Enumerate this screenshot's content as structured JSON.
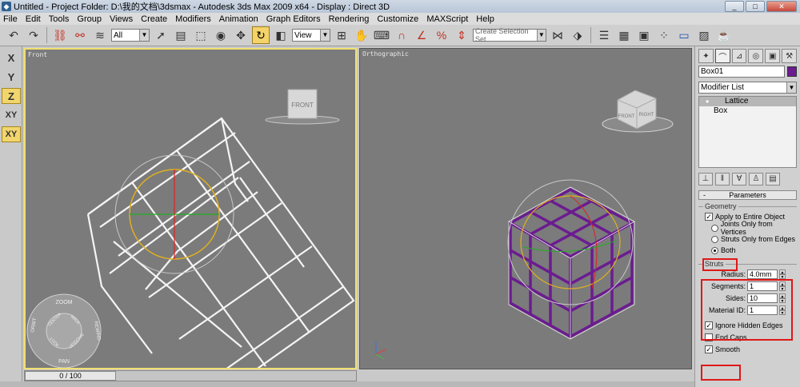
{
  "window": {
    "title": "Untitled    - Project Folder: D:\\我的文档\\3dsmax    - Autodesk 3ds Max  2009 x64    - Display : Direct 3D",
    "buttons": {
      "minimize": "_",
      "maximize": "□",
      "close": "✕"
    }
  },
  "menu": [
    "File",
    "Edit",
    "Tools",
    "Group",
    "Views",
    "Create",
    "Modifiers",
    "Animation",
    "Graph Editors",
    "Rendering",
    "Customize",
    "MAXScript",
    "Help"
  ],
  "toolbar": {
    "filter_select": "All",
    "refcoord_select": "View",
    "named_selection_placeholder": "Create Selection Set"
  },
  "axis_constraints": [
    {
      "label": "X",
      "active": false
    },
    {
      "label": "Y",
      "active": false
    },
    {
      "label": "Z",
      "active": true
    },
    {
      "label": "XY",
      "active": false
    },
    {
      "label": "XY",
      "active": true
    }
  ],
  "viewports": {
    "front": {
      "label": "Front",
      "viewcube_label": "FRONT",
      "wheel": {
        "zoom": "ZOOM",
        "orbit": "ORBIT",
        "center": "CENTER",
        "walk": "WALK",
        "rewind": "REWIND",
        "look": "LOOK",
        "updown": "UP/DOWN",
        "pan": "PAN"
      }
    },
    "ortho": {
      "label": "Orthographic",
      "viewcube_front": "FRONT",
      "viewcube_right": "RIGHT"
    }
  },
  "timeline": {
    "frame": "0 / 100"
  },
  "command_panel": {
    "object_name": "Box01",
    "object_color": "#6b1c90",
    "modifier_list": "Modifier List",
    "stack": [
      {
        "label": "Lattice",
        "selected": true
      },
      {
        "label": "Box",
        "selected": false
      }
    ],
    "parameters": {
      "title": "Parameters",
      "geometry": {
        "title": "Geometry",
        "apply_to_entire": "Apply to Entire Object",
        "opt_joints": "Joints Only from Vertices",
        "opt_struts": "Struts Only from Edges",
        "opt_both": "Both"
      },
      "struts": {
        "title": "Struts",
        "radius_label": "Radius:",
        "radius": "4.0mm",
        "segments_label": "Segments:",
        "segments": "1",
        "sides_label": "Sides:",
        "sides": "10",
        "material_label": "Material ID:",
        "material": "1",
        "ignore_hidden": "Ignore Hidden Edges",
        "end_caps": "End Caps",
        "smooth": "Smooth"
      }
    }
  },
  "accent_colors": {
    "active": "#f1d56d",
    "highlight": "#e01818",
    "lattice_purple": "#6b1c90"
  }
}
